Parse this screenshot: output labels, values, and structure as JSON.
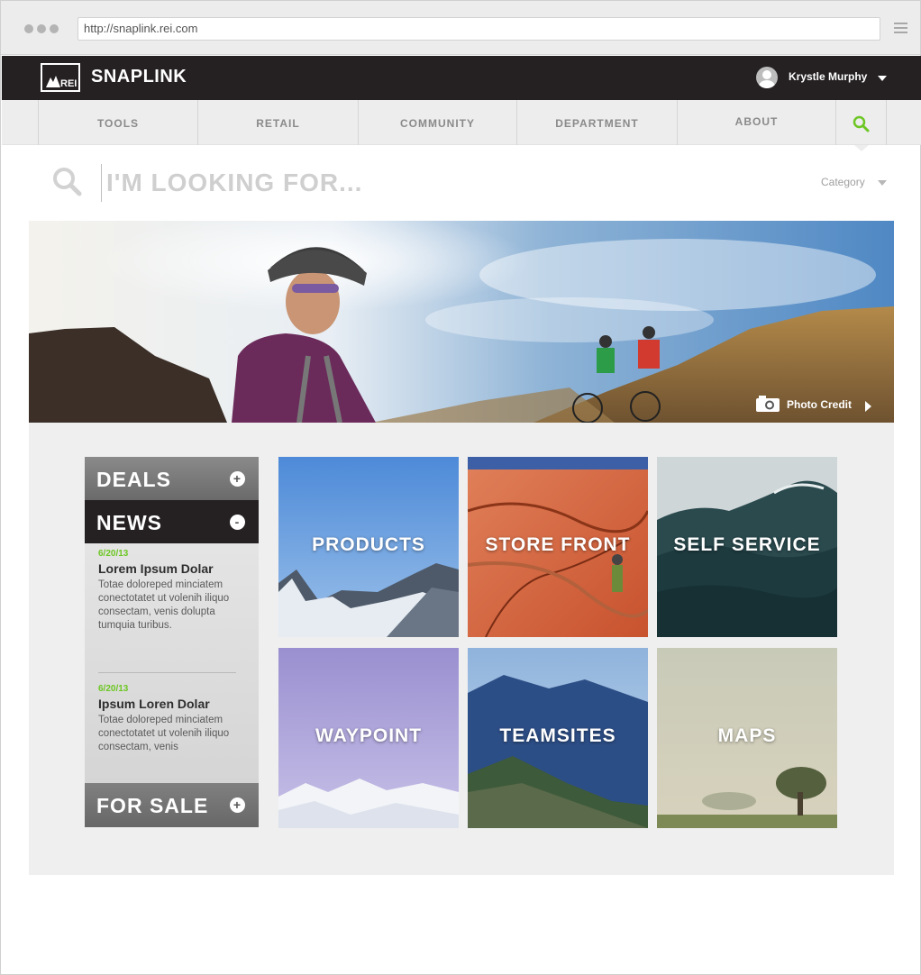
{
  "browser": {
    "url": "http://snaplink.rei.com"
  },
  "header": {
    "logo_text": "REI",
    "brand": "SNAPLINK",
    "user_name": "Krystle Murphy"
  },
  "nav": {
    "items": [
      {
        "label": "TOOLS"
      },
      {
        "label": "RETAIL"
      },
      {
        "label": "COMMUNITY"
      },
      {
        "label": "DEPARTMENT"
      },
      {
        "label": "ABOUT"
      }
    ],
    "search_icon": "search-icon"
  },
  "search": {
    "placeholder": "I'M LOOKING FOR...",
    "category_label": "Category"
  },
  "hero": {
    "credit_label": "Photo Credit"
  },
  "sidebar": {
    "deals": {
      "label": "DEALS",
      "toggle": "+"
    },
    "news": {
      "label": "NEWS",
      "toggle": "-",
      "items": [
        {
          "date": "6/20/13",
          "title": "Lorem Ipsum Dolar",
          "body": "Totae doloreped minciatem conectotatet ut volenih iliquo consectam, venis dolupta tumquia turibus."
        },
        {
          "date": "6/20/13",
          "title": "Ipsum Loren Dolar",
          "body": "Totae doloreped minciatem conectotatet ut volenih iliquo consectam, venis"
        }
      ]
    },
    "for_sale": {
      "label": "FOR SALE",
      "toggle": "+"
    }
  },
  "tiles": [
    {
      "label": "PRODUCTS"
    },
    {
      "label": "STORE FRONT"
    },
    {
      "label": "SELF SERVICE"
    },
    {
      "label": "WAYPOINT"
    },
    {
      "label": "TEAMSITES"
    },
    {
      "label": "MAPS"
    }
  ],
  "colors": {
    "header_bg": "#252122",
    "accent_green": "#6cc623",
    "panel_dark": "#252122",
    "panel_gray": "#6f6f6f"
  }
}
